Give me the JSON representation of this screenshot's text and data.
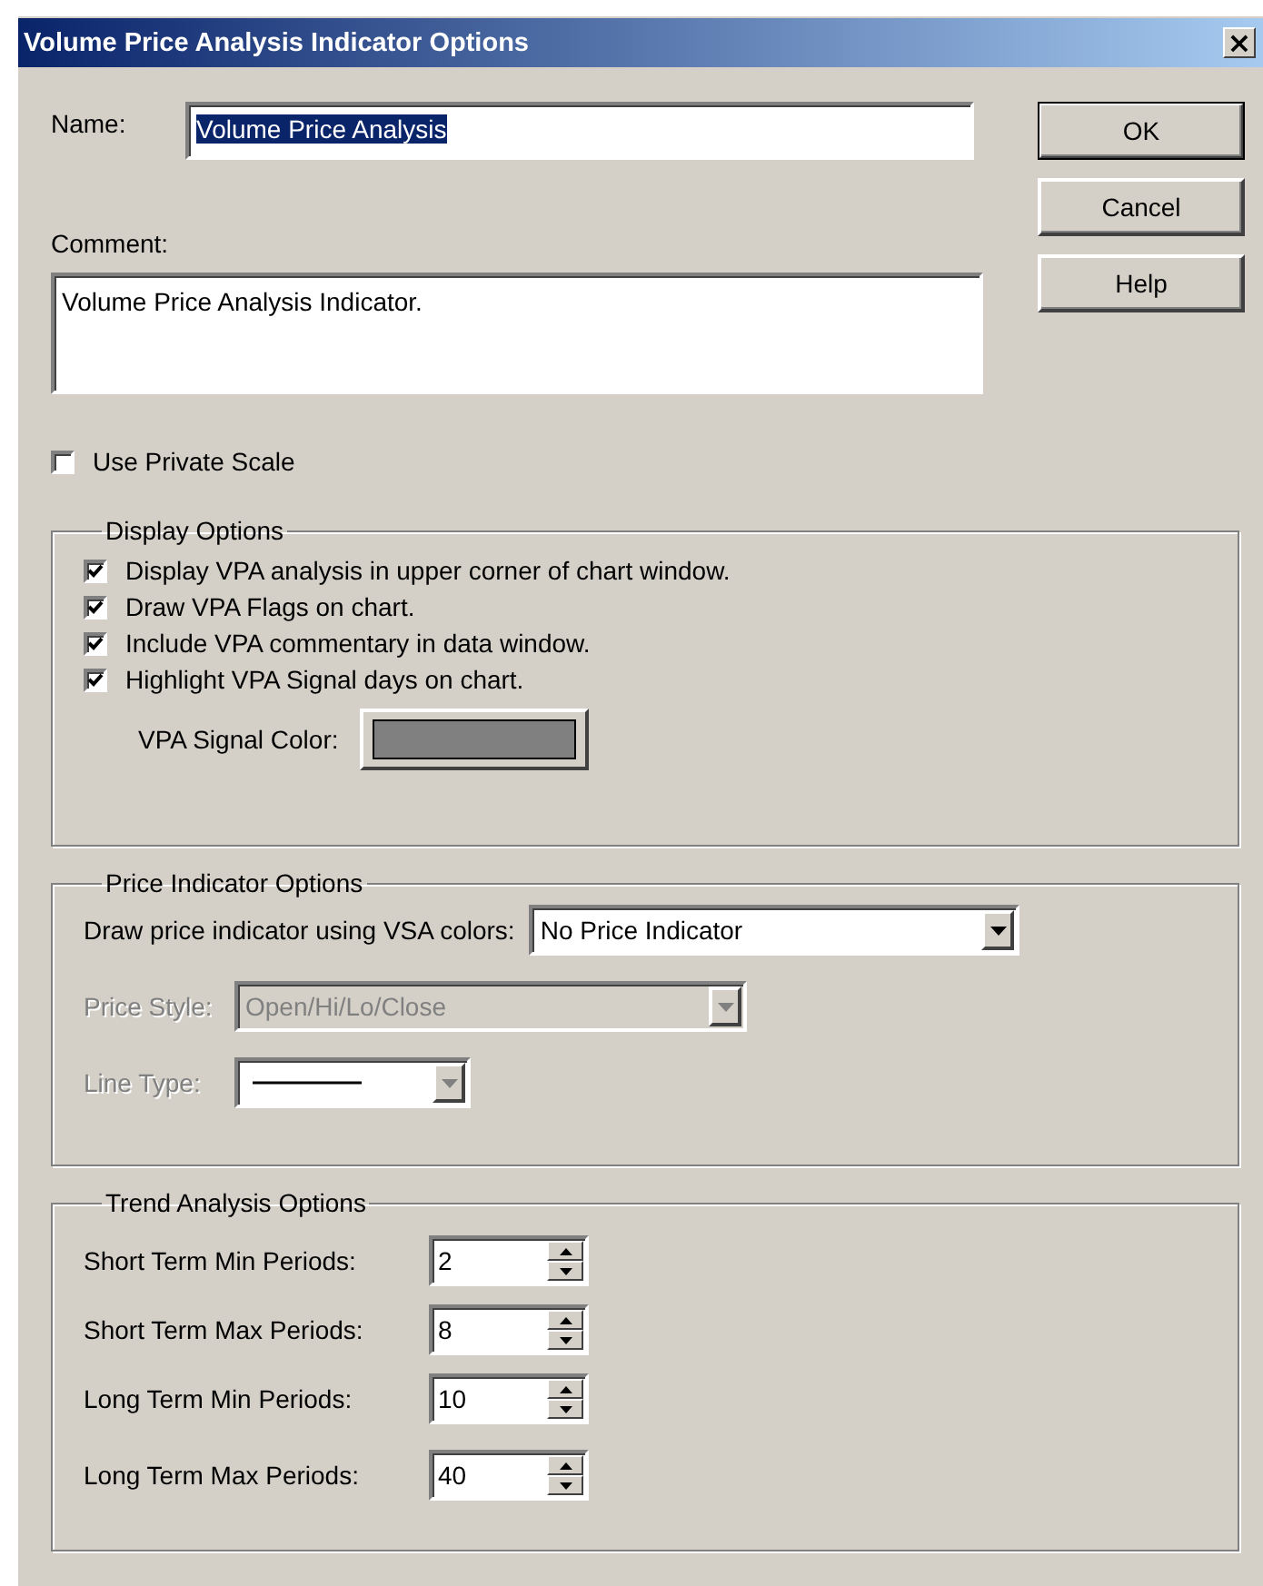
{
  "window": {
    "title": "Volume Price Analysis Indicator Options",
    "close": "×"
  },
  "name": {
    "label": "Name:",
    "value": "Volume Price Analysis",
    "selected": true
  },
  "comment": {
    "label": "Comment:",
    "value": "Volume Price Analysis Indicator."
  },
  "buttons": [
    {
      "label": "OK",
      "default": true
    },
    {
      "label": "Cancel",
      "default": false
    },
    {
      "label": "Help",
      "default": false
    }
  ],
  "use_private_scale": {
    "label": "Use Private Scale",
    "checked": false
  },
  "display_options": {
    "title": "Display Options",
    "items": [
      {
        "label": "Display VPA analysis in upper corner of chart window.",
        "checked": true
      },
      {
        "label": "Draw VPA Flags on chart.",
        "checked": true
      },
      {
        "label": "Include VPA commentary in data window.",
        "checked": true
      },
      {
        "label": "Highlight VPA Signal days on chart.",
        "checked": true
      }
    ],
    "signal_color": {
      "label": "VPA Signal Color:",
      "color": "#808080"
    }
  },
  "price_indicator_options": {
    "title": "Price Indicator Options",
    "fields": [
      {
        "kind": "dropdown",
        "label": "Draw price indicator using VSA colors:",
        "value": "No Price Indicator",
        "disabled": false
      },
      {
        "kind": "dropdown",
        "label": "Price Style:",
        "value": "Open/Hi/Lo/Close",
        "disabled": true
      },
      {
        "kind": "line",
        "label": "Line Type:",
        "disabled": true
      }
    ]
  },
  "trend_analysis_options": {
    "title": "Trend Analysis Options",
    "fields": [
      {
        "label": "Short Term Min Periods:",
        "value": "2"
      },
      {
        "label": "Short Term Max Periods:",
        "value": "8"
      },
      {
        "label": "Long Term Min Periods:",
        "value": "10"
      },
      {
        "label": "Long Term Max Periods:",
        "value": "40"
      }
    ]
  }
}
